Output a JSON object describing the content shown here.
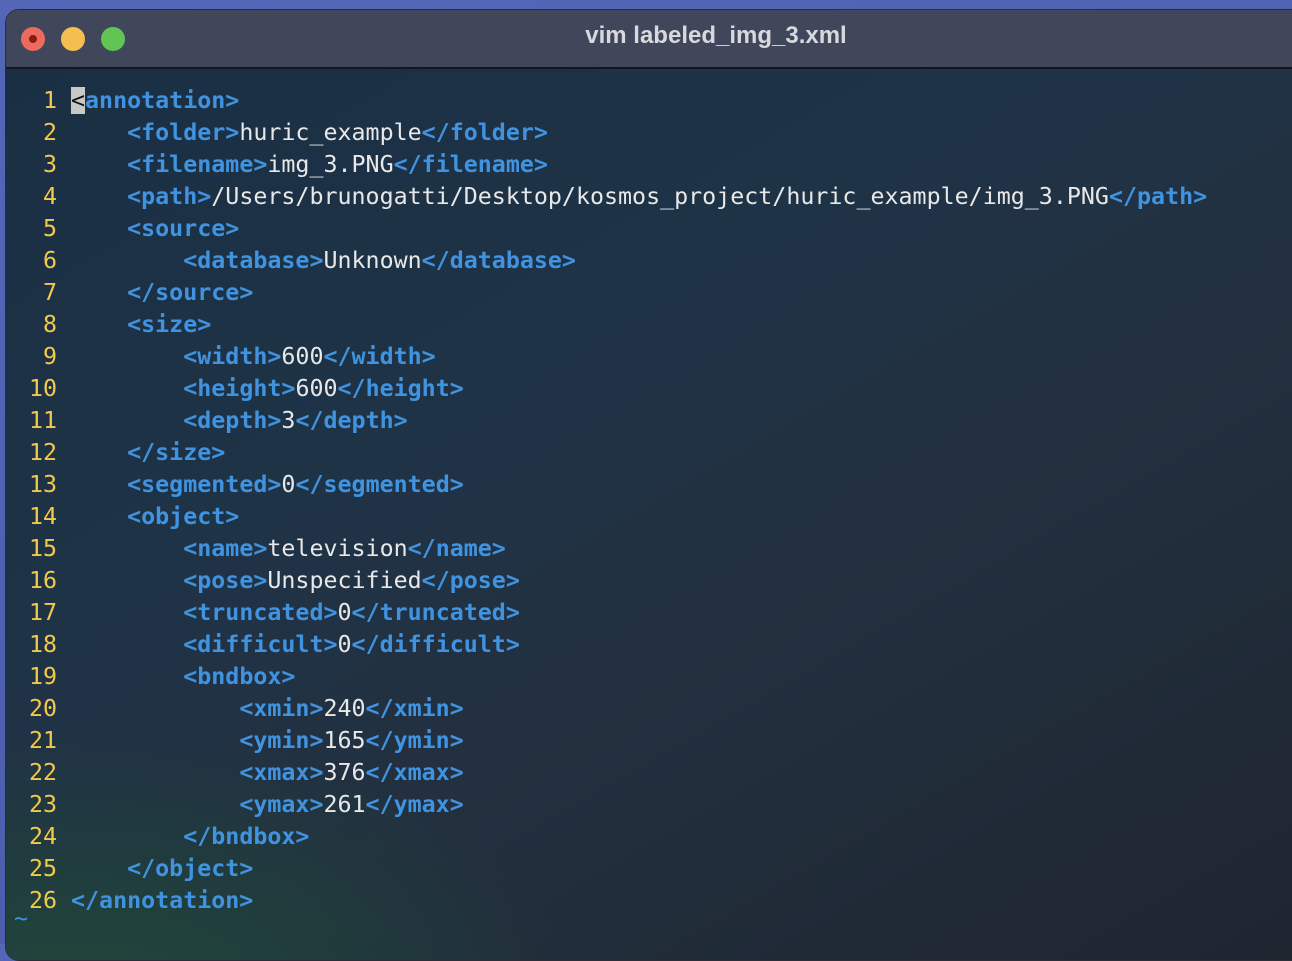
{
  "window": {
    "title": "vim labeled_img_3.xml"
  },
  "editor": {
    "empty_line_marker": "~",
    "lines": [
      {
        "n": "1",
        "indent": "",
        "parts": [
          {
            "k": "cursor",
            "v": "<"
          },
          {
            "k": "tag",
            "v": "annotation>"
          }
        ]
      },
      {
        "n": "2",
        "indent": "    ",
        "parts": [
          {
            "k": "tag",
            "v": "<folder>"
          },
          {
            "k": "txt",
            "v": "huric_example"
          },
          {
            "k": "tag",
            "v": "</folder>"
          }
        ]
      },
      {
        "n": "3",
        "indent": "    ",
        "parts": [
          {
            "k": "tag",
            "v": "<filename>"
          },
          {
            "k": "txt",
            "v": "img_3.PNG"
          },
          {
            "k": "tag",
            "v": "</filename>"
          }
        ]
      },
      {
        "n": "4",
        "indent": "    ",
        "parts": [
          {
            "k": "tag",
            "v": "<path>"
          },
          {
            "k": "txt",
            "v": "/Users/brunogatti/Desktop/kosmos_project/huric_example/img_3.PNG"
          },
          {
            "k": "tag",
            "v": "</path>"
          }
        ]
      },
      {
        "n": "5",
        "indent": "    ",
        "parts": [
          {
            "k": "tag",
            "v": "<source>"
          }
        ]
      },
      {
        "n": "6",
        "indent": "        ",
        "parts": [
          {
            "k": "tag",
            "v": "<database>"
          },
          {
            "k": "txt",
            "v": "Unknown"
          },
          {
            "k": "tag",
            "v": "</database>"
          }
        ]
      },
      {
        "n": "7",
        "indent": "    ",
        "parts": [
          {
            "k": "tag",
            "v": "</source>"
          }
        ]
      },
      {
        "n": "8",
        "indent": "    ",
        "parts": [
          {
            "k": "tag",
            "v": "<size>"
          }
        ]
      },
      {
        "n": "9",
        "indent": "        ",
        "parts": [
          {
            "k": "tag",
            "v": "<width>"
          },
          {
            "k": "txt",
            "v": "600"
          },
          {
            "k": "tag",
            "v": "</width>"
          }
        ]
      },
      {
        "n": "10",
        "indent": "        ",
        "parts": [
          {
            "k": "tag",
            "v": "<height>"
          },
          {
            "k": "txt",
            "v": "600"
          },
          {
            "k": "tag",
            "v": "</height>"
          }
        ]
      },
      {
        "n": "11",
        "indent": "        ",
        "parts": [
          {
            "k": "tag",
            "v": "<depth>"
          },
          {
            "k": "txt",
            "v": "3"
          },
          {
            "k": "tag",
            "v": "</depth>"
          }
        ]
      },
      {
        "n": "12",
        "indent": "    ",
        "parts": [
          {
            "k": "tag",
            "v": "</size>"
          }
        ]
      },
      {
        "n": "13",
        "indent": "    ",
        "parts": [
          {
            "k": "tag",
            "v": "<segmented>"
          },
          {
            "k": "txt",
            "v": "0"
          },
          {
            "k": "tag",
            "v": "</segmented>"
          }
        ]
      },
      {
        "n": "14",
        "indent": "    ",
        "parts": [
          {
            "k": "tag",
            "v": "<object>"
          }
        ]
      },
      {
        "n": "15",
        "indent": "        ",
        "parts": [
          {
            "k": "tag",
            "v": "<name>"
          },
          {
            "k": "txt",
            "v": "television"
          },
          {
            "k": "tag",
            "v": "</name>"
          }
        ]
      },
      {
        "n": "16",
        "indent": "        ",
        "parts": [
          {
            "k": "tag",
            "v": "<pose>"
          },
          {
            "k": "txt",
            "v": "Unspecified"
          },
          {
            "k": "tag",
            "v": "</pose>"
          }
        ]
      },
      {
        "n": "17",
        "indent": "        ",
        "parts": [
          {
            "k": "tag",
            "v": "<truncated>"
          },
          {
            "k": "txt",
            "v": "0"
          },
          {
            "k": "tag",
            "v": "</truncated>"
          }
        ]
      },
      {
        "n": "18",
        "indent": "        ",
        "parts": [
          {
            "k": "tag",
            "v": "<difficult>"
          },
          {
            "k": "txt",
            "v": "0"
          },
          {
            "k": "tag",
            "v": "</difficult>"
          }
        ]
      },
      {
        "n": "19",
        "indent": "        ",
        "parts": [
          {
            "k": "tag",
            "v": "<bndbox>"
          }
        ]
      },
      {
        "n": "20",
        "indent": "            ",
        "parts": [
          {
            "k": "tag",
            "v": "<xmin>"
          },
          {
            "k": "txt",
            "v": "240"
          },
          {
            "k": "tag",
            "v": "</xmin>"
          }
        ]
      },
      {
        "n": "21",
        "indent": "            ",
        "parts": [
          {
            "k": "tag",
            "v": "<ymin>"
          },
          {
            "k": "txt",
            "v": "165"
          },
          {
            "k": "tag",
            "v": "</ymin>"
          }
        ]
      },
      {
        "n": "22",
        "indent": "            ",
        "parts": [
          {
            "k": "tag",
            "v": "<xmax>"
          },
          {
            "k": "txt",
            "v": "376"
          },
          {
            "k": "tag",
            "v": "</xmax>"
          }
        ]
      },
      {
        "n": "23",
        "indent": "            ",
        "parts": [
          {
            "k": "tag",
            "v": "<ymax>"
          },
          {
            "k": "txt",
            "v": "261"
          },
          {
            "k": "tag",
            "v": "</ymax>"
          }
        ]
      },
      {
        "n": "24",
        "indent": "        ",
        "parts": [
          {
            "k": "tag",
            "v": "</bndbox>"
          }
        ]
      },
      {
        "n": "25",
        "indent": "    ",
        "parts": [
          {
            "k": "tag",
            "v": "</object>"
          }
        ]
      },
      {
        "n": "26",
        "indent": "",
        "parts": [
          {
            "k": "tag",
            "v": "</annotation>"
          }
        ]
      }
    ]
  }
}
